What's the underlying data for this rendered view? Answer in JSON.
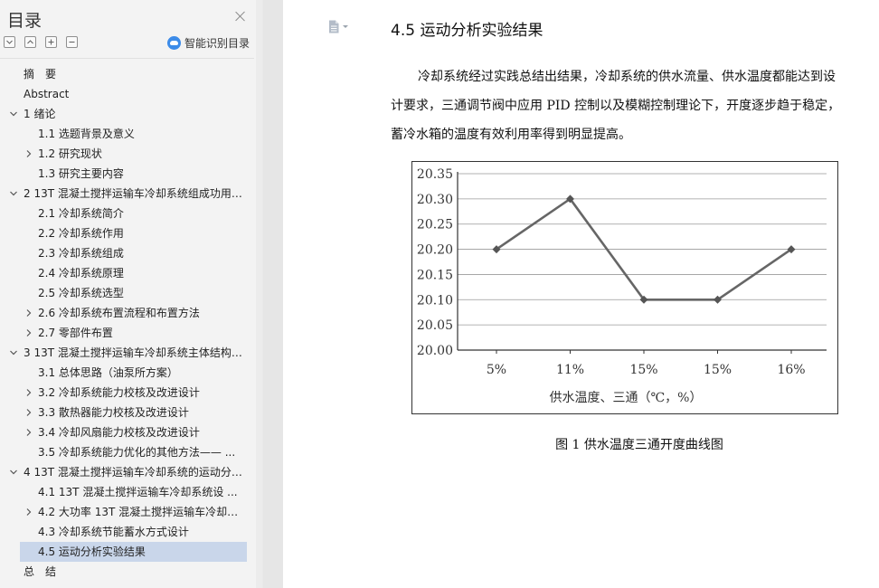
{
  "sidebar": {
    "title": "目录",
    "smart_label": "智能识别目录",
    "items": [
      {
        "text": "摘　要",
        "level": 0,
        "toggle": "none"
      },
      {
        "text": "Abstract",
        "level": 0,
        "toggle": "none"
      },
      {
        "text": "1 绪论",
        "level": 0,
        "toggle": "down"
      },
      {
        "text": "1.1 选题背景及意义",
        "level": 1,
        "toggle": "none"
      },
      {
        "text": "1.2 研究现状",
        "level": 1,
        "toggle": "right"
      },
      {
        "text": "1.3 研究主要内容",
        "level": 1,
        "toggle": "none"
      },
      {
        "text": "2 13T 混凝土搅拌运输车冷却系统组成功用 ...",
        "level": 0,
        "toggle": "down"
      },
      {
        "text": "2.1  冷却系统简介",
        "level": 1,
        "toggle": "none"
      },
      {
        "text": "2.2  冷却系统作用",
        "level": 1,
        "toggle": "none"
      },
      {
        "text": "2.3  冷却系统组成",
        "level": 1,
        "toggle": "none"
      },
      {
        "text": "2.4  冷却系统原理",
        "level": 1,
        "toggle": "none"
      },
      {
        "text": "2.5  冷却系统选型",
        "level": 1,
        "toggle": "none"
      },
      {
        "text": "2.6 冷却系统布置流程和布置方法",
        "level": 1,
        "toggle": "right"
      },
      {
        "text": "2.7 零部件布置",
        "level": 1,
        "toggle": "right"
      },
      {
        "text": "3 13T 混凝土搅拌运输车冷却系统主体结构 ...",
        "level": 0,
        "toggle": "down"
      },
      {
        "text": "3.1  总体思路（油泵所方案）",
        "level": 1,
        "toggle": "none"
      },
      {
        "text": "3.2 冷却系统能力校核及改进设计",
        "level": 1,
        "toggle": "right"
      },
      {
        "text": "3.3 散热器能力校核及改进设计",
        "level": 1,
        "toggle": "right"
      },
      {
        "text": "3.4 冷却风扇能力校核及改进设计",
        "level": 1,
        "toggle": "right"
      },
      {
        "text": "3.5 冷却系统能力优化的其他方法—— ...",
        "level": 1,
        "toggle": "none"
      },
      {
        "text": "4 13T 混凝土搅拌运输车冷却系统的运动分 ...",
        "level": 0,
        "toggle": "down"
      },
      {
        "text": "4.1 13T 混凝土搅拌运输车冷却系统设 ...",
        "level": 1,
        "toggle": "none"
      },
      {
        "text": "4.2 大功率 13T 混凝土搅拌运输车冷却 ...",
        "level": 1,
        "toggle": "right"
      },
      {
        "text": "4.3 冷却系统节能蓄水方式设计",
        "level": 1,
        "toggle": "none"
      },
      {
        "text": "4.5 运动分析实验结果",
        "level": 1,
        "toggle": "none",
        "active": true
      },
      {
        "text": "总　结",
        "level": 0,
        "toggle": "none"
      }
    ]
  },
  "document": {
    "heading": "4.5 运动分析实验结果",
    "paragraph_lines": [
      "冷却系统经过实践总结出结果，冷却系统的供水流量、供水温度都能达到设",
      "计要求，三通调节阀中应用 PID 控制以及模糊控制理论下，开度逐步趋于稳定，",
      "蓄冷水箱的温度有效利用率得到明显提高。"
    ],
    "caption": "图 1  供水温度三通开度曲线图"
  },
  "chart_data": {
    "type": "line",
    "categories": [
      "5%",
      "11%",
      "15%",
      "15%",
      "16%"
    ],
    "values": [
      20.2,
      20.3,
      20.1,
      20.1,
      20.2
    ],
    "xlabel": "供水温度、三通（℃，%）",
    "ylim": [
      20.0,
      20.35
    ],
    "yticks": [
      "20.35",
      "20.30",
      "20.25",
      "20.20",
      "20.15",
      "20.10",
      "20.05",
      "20.00"
    ],
    "grid": true
  },
  "colors": {
    "active_item_bg": "#c9d6ea",
    "smart_icon": "#3c8be8",
    "line": "#666666"
  }
}
